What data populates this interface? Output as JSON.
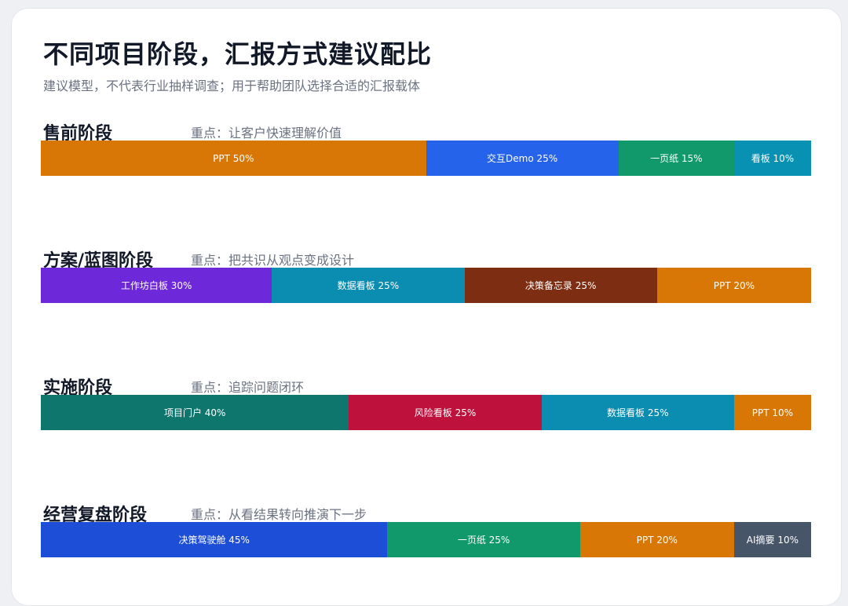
{
  "title": "不同项目阶段，汇报方式建议配比",
  "subtitle": "建议模型，不代表行业抽样调查；用于帮助团队选择合适的汇报载体",
  "colors": {
    "PPT": "#d97706",
    "交互Demo": "#2563eb",
    "一页纸": "#12996b",
    "看板": "#0891b2",
    "工作坊白板": "#6d28d9",
    "数据看板": "#0a8db0",
    "决策备忘录": "#7c2d12",
    "项目门户": "#0f766e",
    "风险看板": "#be123c",
    "决策驾驶舱": "#1d4ed8",
    "AI摘要": "#475569"
  },
  "chart_data": {
    "type": "bar",
    "subtype": "100%-stacked-horizontal",
    "unit": "%",
    "categories": [
      "售前阶段",
      "方案/蓝图阶段",
      "实施阶段",
      "经营复盘阶段"
    ],
    "stages": [
      {
        "name": "售前阶段",
        "focus": "重点：让客户快速理解价值",
        "segments": [
          {
            "name": "PPT",
            "value": 50,
            "label": "PPT 50%"
          },
          {
            "name": "交互Demo",
            "value": 25,
            "label": "交互Demo 25%"
          },
          {
            "name": "一页纸",
            "value": 15,
            "label": "一页纸 15%"
          },
          {
            "name": "看板",
            "value": 10,
            "label": "看板 10%"
          }
        ]
      },
      {
        "name": "方案/蓝图阶段",
        "focus": "重点：把共识从观点变成设计",
        "segments": [
          {
            "name": "工作坊白板",
            "value": 30,
            "label": "工作坊白板 30%"
          },
          {
            "name": "数据看板",
            "value": 25,
            "label": "数据看板 25%"
          },
          {
            "name": "决策备忘录",
            "value": 25,
            "label": "决策备忘录 25%"
          },
          {
            "name": "PPT",
            "value": 20,
            "label": "PPT 20%"
          }
        ]
      },
      {
        "name": "实施阶段",
        "focus": "重点：追踪问题闭环",
        "segments": [
          {
            "name": "项目门户",
            "value": 40,
            "label": "项目门户 40%"
          },
          {
            "name": "风险看板",
            "value": 25,
            "label": "风险看板 25%"
          },
          {
            "name": "数据看板",
            "value": 25,
            "label": "数据看板 25%"
          },
          {
            "name": "PPT",
            "value": 10,
            "label": "PPT 10%"
          }
        ]
      },
      {
        "name": "经营复盘阶段",
        "focus": "重点：从看结果转向推演下一步",
        "segments": [
          {
            "name": "决策驾驶舱",
            "value": 45,
            "label": "决策驾驶舱 45%"
          },
          {
            "name": "一页纸",
            "value": 25,
            "label": "一页纸 25%"
          },
          {
            "name": "PPT",
            "value": 20,
            "label": "PPT 20%"
          },
          {
            "name": "AI摘要",
            "value": 10,
            "label": "AI摘要 10%"
          }
        ]
      }
    ]
  }
}
